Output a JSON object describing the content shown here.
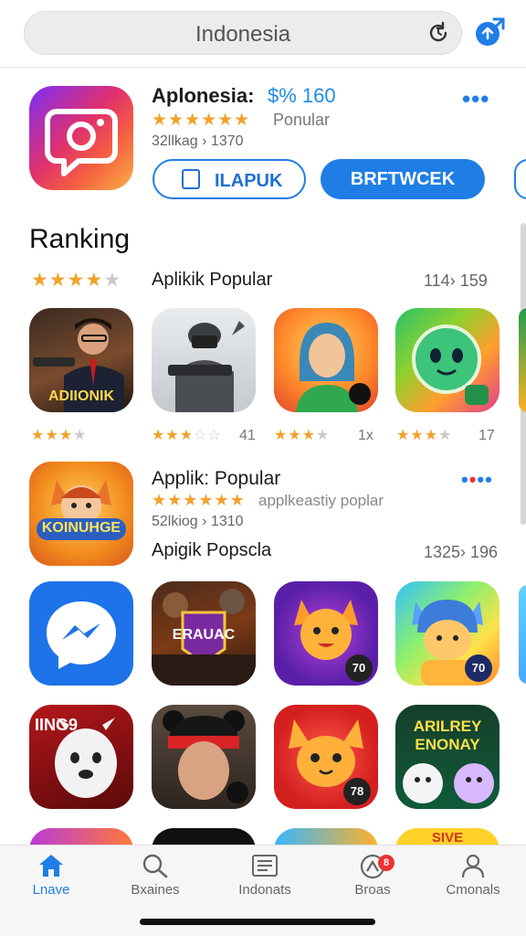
{
  "search": {
    "value": "Indonesia"
  },
  "featured": {
    "title": "Aplonesia:",
    "price": "$% 160",
    "more": "•••",
    "rating_stars": 4.5,
    "tag": "Ponular",
    "meta": "32llkag › 1370",
    "outline_button_label": "ILAPUK",
    "primary_button_label": "BRFTWCEK"
  },
  "ranking": {
    "title": "Ranking",
    "section_stars": 4,
    "section_label": "Aplikik Popular",
    "section_count": "114› 159",
    "row1": [
      {
        "tile_text": "ADIIONIK",
        "stars": 3,
        "count": ""
      },
      {
        "tile_text": "",
        "stars": 3,
        "count": "41"
      },
      {
        "tile_text": "",
        "stars": 3,
        "count": "1x"
      },
      {
        "tile_text": "",
        "stars": 3,
        "count": "17"
      }
    ]
  },
  "featured2": {
    "tile_text": "KOINUHGE",
    "title": "Applik: Popular",
    "more": "•••",
    "rating_stars": 4.5,
    "tag": "applkeastiy poplar",
    "meta": "52lkiog › 1310",
    "sub_label": "Apigik Popscla",
    "sub_count": "1325› 196"
  },
  "grid": {
    "row2": [
      {
        "tile_text": "",
        "badge": ""
      },
      {
        "tile_text": "ERAUAC",
        "badge": ""
      },
      {
        "tile_text": "",
        "badge": "70"
      },
      {
        "tile_text": "",
        "badge": "70"
      }
    ],
    "row3": [
      {
        "tile_text": "IING9",
        "badge": ""
      },
      {
        "tile_text": "",
        "badge": ""
      },
      {
        "tile_text": "",
        "badge": "78"
      },
      {
        "tile_text": "ARILREY ENONAY",
        "badge": ""
      }
    ],
    "row4_peek": [
      {
        "tile_text": ""
      },
      {
        "tile_text": ""
      },
      {
        "tile_text": ""
      },
      {
        "tile_text": "SIVE"
      }
    ]
  },
  "bottom_nav": [
    {
      "label": "Lnave",
      "icon": "home-icon",
      "active": true
    },
    {
      "label": "Bxaines",
      "icon": "search-icon",
      "active": false
    },
    {
      "label": "Indonats",
      "icon": "list-icon",
      "active": false
    },
    {
      "label": "Broas",
      "icon": "apps-icon",
      "active": false,
      "badge": "8"
    },
    {
      "label": "Cmonals",
      "icon": "profile-icon",
      "active": false
    }
  ],
  "colors": {
    "accent": "#1f7ee6",
    "star": "#f2a12b",
    "badge": "#e33333"
  }
}
